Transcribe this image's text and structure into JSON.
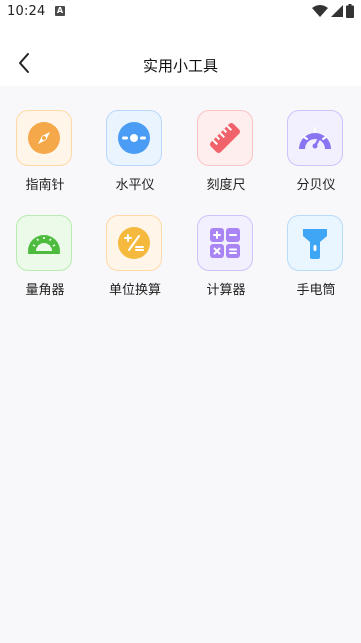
{
  "status_bar": {
    "time": "10:24",
    "notification_letter": "A"
  },
  "header": {
    "title": "实用小工具"
  },
  "tools": [
    {
      "label": "指南针",
      "icon": "compass-icon",
      "color": "#f5a84a"
    },
    {
      "label": "水平仪",
      "icon": "level-icon",
      "color": "#4b9cf5"
    },
    {
      "label": "刻度尺",
      "icon": "ruler-icon",
      "color": "#f0636a"
    },
    {
      "label": "分贝仪",
      "icon": "decibel-meter-icon",
      "color": "#8b74f2"
    },
    {
      "label": "量角器",
      "icon": "protractor-icon",
      "color": "#4cbb3e"
    },
    {
      "label": "单位换算",
      "icon": "unit-conversion-icon",
      "color": "#f4b93d"
    },
    {
      "label": "计算器",
      "icon": "calculator-icon",
      "color": "#a884f4"
    },
    {
      "label": "手电筒",
      "icon": "flashlight-icon",
      "color": "#3fa6f5"
    }
  ]
}
